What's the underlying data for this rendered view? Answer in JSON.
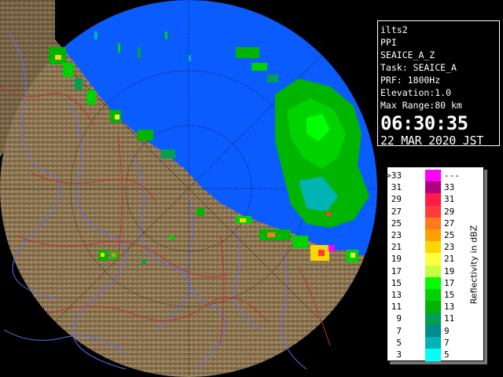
{
  "info": {
    "radar_name": "ilts2",
    "product": "PPI",
    "product_name": "SEAICE_A_Z",
    "task": "Task: SEAICE_A",
    "prf": "PRF: 1800Hz",
    "elevation": "Elevation:1.0",
    "max_range": "Max Range:80 km",
    "time": "06:30:35",
    "date": "22 MAR 2020 JST"
  },
  "legend": {
    "title": "Reflectivity in dBZ",
    "rows": [
      {
        "lo": ">33",
        "hi": "---",
        "color": "#ff00ff"
      },
      {
        "lo": "31",
        "hi": "33",
        "color": "#b0007f"
      },
      {
        "lo": "29",
        "hi": "31",
        "color": "#ff1a4a"
      },
      {
        "lo": "27",
        "hi": "29",
        "color": "#ff3a3a"
      },
      {
        "lo": "25",
        "hi": "27",
        "color": "#ff7a1a"
      },
      {
        "lo": "23",
        "hi": "25",
        "color": "#ffa000"
      },
      {
        "lo": "21",
        "hi": "23",
        "color": "#ffd700"
      },
      {
        "lo": "19",
        "hi": "21",
        "color": "#ffff40"
      },
      {
        "lo": "17",
        "hi": "19",
        "color": "#c8ff40"
      },
      {
        "lo": "15",
        "hi": "17",
        "color": "#00ff00"
      },
      {
        "lo": "13",
        "hi": "15",
        "color": "#00d200"
      },
      {
        "lo": "11",
        "hi": "13",
        "color": "#00b400"
      },
      {
        "lo": "9",
        "hi": "11",
        "color": "#00a050"
      },
      {
        "lo": "7",
        "hi": "9",
        "color": "#008c8c"
      },
      {
        "lo": "5",
        "hi": "7",
        "color": "#00b4b4"
      },
      {
        "lo": "3",
        "hi": "5",
        "color": "#00ffff"
      }
    ]
  },
  "colors": {
    "sea": "#0a5cff",
    "land": "#8a7250",
    "outside": "#000000",
    "ring": "#000000",
    "rivers": "#5b6cff",
    "borders": "#c0302a"
  }
}
